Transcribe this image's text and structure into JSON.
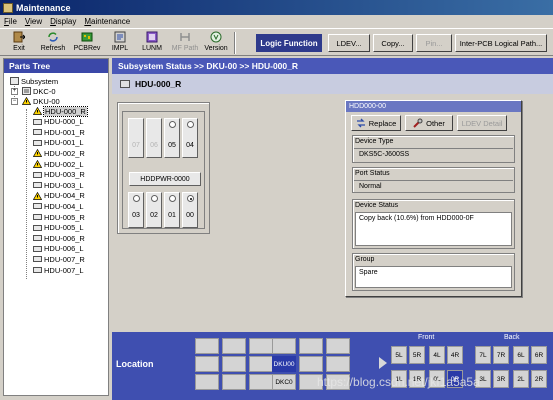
{
  "window": {
    "title": "Maintenance"
  },
  "menu": [
    "File",
    "View",
    "Display",
    "Maintenance"
  ],
  "toolbar": {
    "buttons": [
      {
        "label": "Exit",
        "icon": "exit-icon"
      },
      {
        "label": "Refresh",
        "icon": "refresh-icon"
      },
      {
        "label": "PCBRev",
        "icon": "pcbrev-icon"
      },
      {
        "label": "IMPL",
        "icon": "impl-icon"
      },
      {
        "label": "LUNM",
        "icon": "lunm-icon"
      },
      {
        "label": "MF Path",
        "icon": "mf-path-icon",
        "disabled": true
      },
      {
        "label": "Version",
        "icon": "version-icon"
      }
    ],
    "logic_function_label": "Logic Function",
    "logic_buttons": [
      {
        "label": "LDEV..."
      },
      {
        "label": "Copy..."
      },
      {
        "label": "Pin...",
        "disabled": true
      },
      {
        "label": "Inter-PCB Logical Path..."
      }
    ]
  },
  "parts_tree": {
    "title": "Parts Tree",
    "items": [
      {
        "label": "Subsystem"
      },
      {
        "label": "DKC-0"
      },
      {
        "label": "DKU-00",
        "warning": true
      },
      {
        "label": "HDU-000_R",
        "warning": true,
        "selected": true
      },
      {
        "label": "HDU-000_L"
      },
      {
        "label": "HDU-001_R"
      },
      {
        "label": "HDU-001_L"
      },
      {
        "label": "HDU-002_R",
        "warning": true
      },
      {
        "label": "HDU-002_L",
        "warning": true
      },
      {
        "label": "HDU-003_R"
      },
      {
        "label": "HDU-003_L"
      },
      {
        "label": "HDU-004_R",
        "warning": true
      },
      {
        "label": "HDU-004_L"
      },
      {
        "label": "HDU-005_R"
      },
      {
        "label": "HDU-005_L"
      },
      {
        "label": "HDU-006_R"
      },
      {
        "label": "HDU-006_L"
      },
      {
        "label": "HDU-007_R"
      },
      {
        "label": "HDU-007_L"
      }
    ]
  },
  "path_bar": "Subsystem Status >> DKU-00 >> HDU-000_R",
  "sub_title": "HDU-000_R",
  "slots": {
    "top_row": [
      {
        "num": "07",
        "disabled": true
      },
      {
        "num": "06",
        "disabled": true
      },
      {
        "num": "05",
        "radio": true
      },
      {
        "num": "04",
        "radio": true
      }
    ],
    "power_button": "HDDPWR-0000",
    "bottom_row": [
      {
        "num": "03",
        "radio": true
      },
      {
        "num": "02",
        "radio": true
      },
      {
        "num": "01",
        "radio": true
      },
      {
        "num": "00",
        "radio": true,
        "checked": true
      }
    ]
  },
  "dialog": {
    "title": "HDD000-00",
    "buttons": [
      {
        "label": "Replace",
        "icon": "replace-icon"
      },
      {
        "label": "Other",
        "icon": "other-icon"
      },
      {
        "label": "LDEV Detail",
        "disabled": true
      }
    ],
    "device_type_label": "Device Type",
    "device_type_value": "DKS5C-J600SS",
    "port_status_label": "Port Status",
    "port_status_value": "Normal",
    "device_status_label": "Device Status",
    "device_status_value": "Copy back (10.6%) from HDD000-0F",
    "group_label": "Group",
    "group_value": "Spare"
  },
  "location": {
    "label": "Location",
    "cabinet_active": "DKU00",
    "cabinet_controller": "DKC0",
    "front_label": "Front",
    "back_label": "Back",
    "front_top": [
      "5L",
      "5R",
      "4L",
      "4R"
    ],
    "front_bottom": [
      "1L",
      "1R",
      "0L",
      "0R"
    ],
    "back_top": [
      "7L",
      "7R",
      "6L",
      "6R"
    ],
    "back_bottom": [
      "3L",
      "3R",
      "2L",
      "2R"
    ],
    "watermark": "https://blog.csdn.net/jkf1a5a5a"
  }
}
